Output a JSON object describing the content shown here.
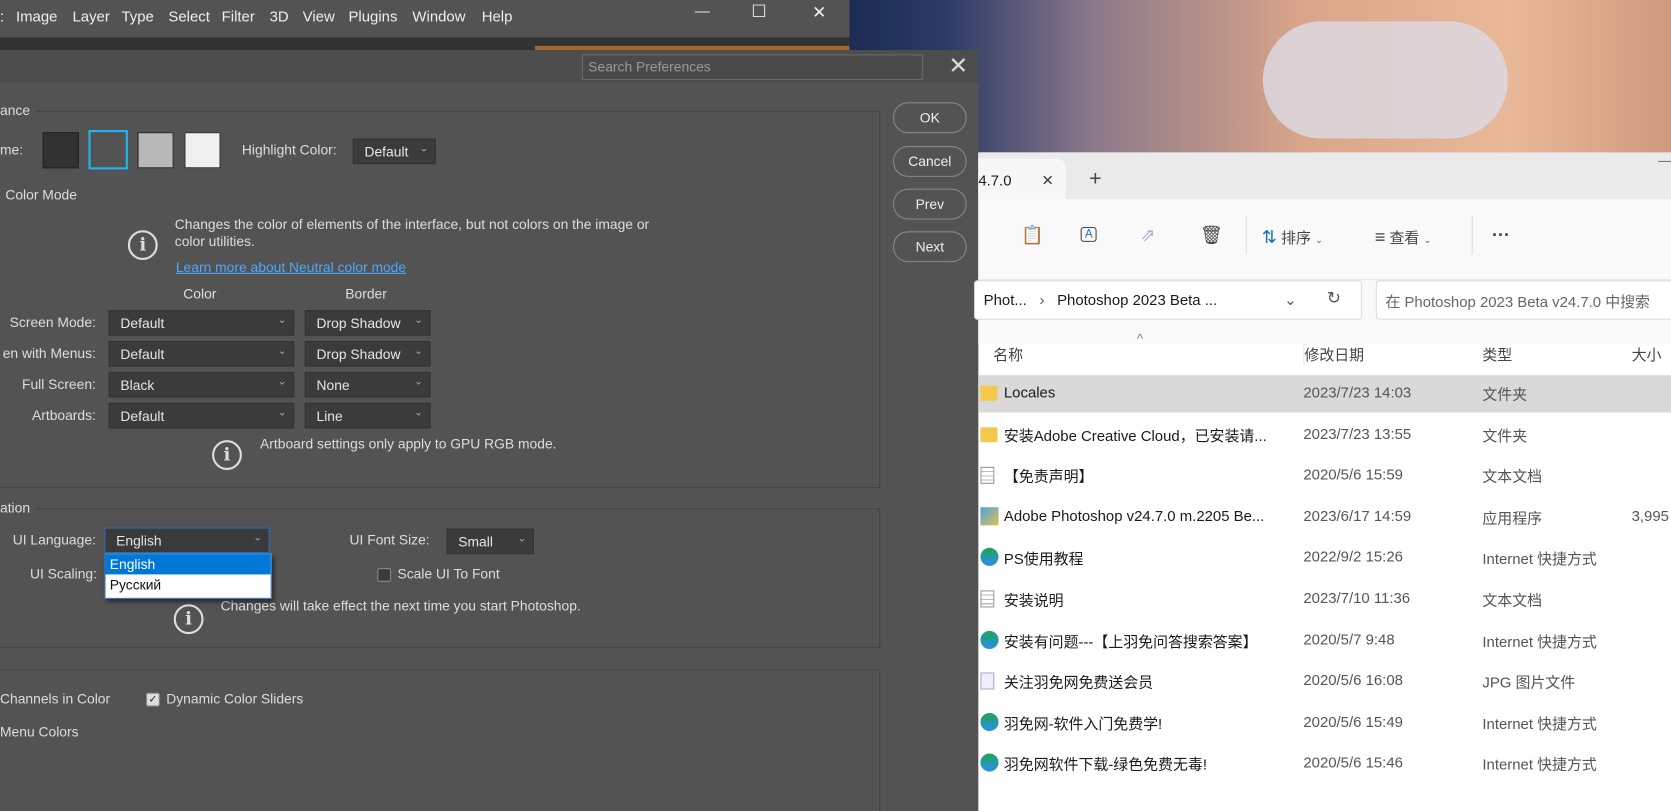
{
  "menubar": {
    "items": [
      "Image",
      "Layer",
      "Type",
      "Select",
      "Filter",
      "3D",
      "View",
      "Plugins",
      "Window",
      "Help"
    ],
    "minimize": "—",
    "maximize": "☐",
    "close": "✕"
  },
  "prefs": {
    "search_placeholder": "Search Preferences",
    "close": "✕",
    "buttons": {
      "ok": "OK",
      "cancel": "Cancel",
      "prev": "Prev",
      "next": "Next"
    },
    "appearance": {
      "title": "ance",
      "theme_label": "me:",
      "highlight_label": "Highlight Color:",
      "highlight_value": "Default",
      "neutral_label": "Color Mode",
      "info": "Changes the color of elements of the interface, but not colors on the image or color utilities.",
      "link": "Learn more about Neutral color mode",
      "col_color": "Color",
      "col_border": "Border",
      "rows": [
        {
          "label": "Screen Mode:",
          "color": "Default",
          "border": "Drop Shadow"
        },
        {
          "label": "en with Menus:",
          "color": "Default",
          "border": "Drop Shadow"
        },
        {
          "label": "Full Screen:",
          "color": "Black",
          "border": "None"
        },
        {
          "label": "Artboards:",
          "color": "Default",
          "border": "Line"
        }
      ],
      "artboard_info": "Artboard settings only apply to GPU RGB mode."
    },
    "text": {
      "title": "ation",
      "lang_label": "UI Language:",
      "lang_value": "English",
      "font_label": "UI Font Size:",
      "font_value": "Small",
      "scaling_label": "UI Scaling:",
      "scale_font": "Scale UI To Font",
      "info": "Changes will take effect the next time you start Photoshop.",
      "lang_options": [
        "English",
        "Русский"
      ]
    },
    "options": {
      "channels": "Channels in Color",
      "dynamic": "Dynamic Color Sliders",
      "menu_colors": "Menu Colors"
    }
  },
  "explorer": {
    "tab": "4.7.0",
    "tab_close": "✕",
    "new_tab": "+",
    "toolbar": {
      "sort": "排序",
      "view": "查看",
      "more": "···"
    },
    "breadcrumb": [
      "Phot...",
      "Photoshop 2023 Beta ..."
    ],
    "search_placeholder": "在 Photoshop 2023 Beta v24.7.0 中搜索",
    "columns": [
      "名称",
      "修改日期",
      "类型",
      "大小"
    ],
    "rows": [
      {
        "name": "Locales",
        "date": "2023/7/23 14:03",
        "type": "文件夹",
        "size": "",
        "icon": "folder"
      },
      {
        "name": "安装Adobe Creative Cloud，已安装请...",
        "date": "2023/7/23 13:55",
        "type": "文件夹",
        "size": "",
        "icon": "folder"
      },
      {
        "name": "【免责声明】",
        "date": "2020/5/6 15:59",
        "type": "文本文档",
        "size": "",
        "icon": "text"
      },
      {
        "name": "Adobe Photoshop v24.7.0 m.2205 Be...",
        "date": "2023/6/17 14:59",
        "type": "应用程序",
        "size": "3,995",
        "icon": "app"
      },
      {
        "name": "PS使用教程",
        "date": "2022/9/2 15:26",
        "type": "Internet 快捷方式",
        "size": "",
        "icon": "edge"
      },
      {
        "name": "安装说明",
        "date": "2023/7/10 11:36",
        "type": "文本文档",
        "size": "",
        "icon": "text"
      },
      {
        "name": "安装有问题---【上羽免问答搜索答案】",
        "date": "2020/5/7 9:48",
        "type": "Internet 快捷方式",
        "size": "",
        "icon": "edge"
      },
      {
        "name": "关注羽免网免费送会员",
        "date": "2020/5/6 16:08",
        "type": "JPG 图片文件",
        "size": "",
        "icon": "image"
      },
      {
        "name": "羽免网-软件入门免费学!",
        "date": "2020/5/6 15:49",
        "type": "Internet 快捷方式",
        "size": "",
        "icon": "edge"
      },
      {
        "name": "羽免网软件下载-绿色免费无毒!",
        "date": "2020/5/6 15:46",
        "type": "Internet 快捷方式",
        "size": "",
        "icon": "edge"
      }
    ]
  },
  "colors": {
    "accent": "#0078d7",
    "link": "#4ea6ff",
    "swatch_selected": "#1eb5f0"
  }
}
